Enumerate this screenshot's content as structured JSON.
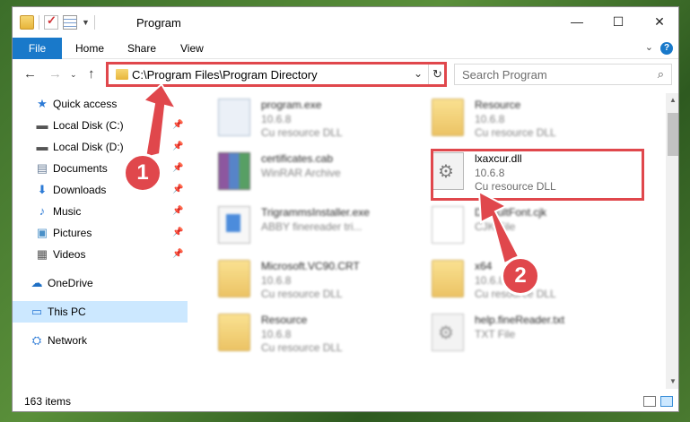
{
  "window": {
    "title": "Program",
    "controls": {
      "minimize": "—",
      "maximize": "☐",
      "close": "✕"
    }
  },
  "ribbon": {
    "tabs": [
      "File",
      "Home",
      "Share",
      "View"
    ],
    "help": "?"
  },
  "address": {
    "path": "C:\\Program Files\\Program Directory",
    "search_placeholder": "Search Program"
  },
  "sidebar": {
    "items": [
      {
        "label": "Quick access",
        "icon": "star-icon",
        "glyph": "★",
        "color": "#2d7bd6",
        "pinned": false
      },
      {
        "label": "Local Disk (C:)",
        "icon": "drive-icon",
        "glyph": "▬",
        "color": "#555555",
        "pinned": true
      },
      {
        "label": "Local Disk (D:)",
        "icon": "drive-icon",
        "glyph": "▬",
        "color": "#555555",
        "pinned": true
      },
      {
        "label": "Documents",
        "icon": "documents-icon",
        "glyph": "▤",
        "color": "#6b7f99",
        "pinned": true
      },
      {
        "label": "Downloads",
        "icon": "download-icon",
        "glyph": "⬇",
        "color": "#2d7bd6",
        "pinned": true
      },
      {
        "label": "Music",
        "icon": "music-icon",
        "glyph": "♪",
        "color": "#2d7bd6",
        "pinned": true
      },
      {
        "label": "Pictures",
        "icon": "pictures-icon",
        "glyph": "▣",
        "color": "#4a90c8",
        "pinned": true
      },
      {
        "label": "Videos",
        "icon": "videos-icon",
        "glyph": "▦",
        "color": "#555555",
        "pinned": true
      },
      {
        "label": "OneDrive",
        "icon": "cloud-icon",
        "glyph": "☁",
        "color": "#1e6fc4",
        "pinned": false
      },
      {
        "label": "This PC",
        "icon": "computer-icon",
        "glyph": "▭",
        "color": "#2d7bd6",
        "pinned": false
      },
      {
        "label": "Network",
        "icon": "network-icon",
        "glyph": "⛭",
        "color": "#2d7bd6",
        "pinned": false
      }
    ]
  },
  "files": [
    {
      "name": "program.exe",
      "sub1": "10.6.8",
      "sub2": "Cu resource DLL",
      "icon": "exe",
      "blurred": true
    },
    {
      "name": "Resource",
      "sub1": "10.6.8",
      "sub2": "Cu resource DLL",
      "icon": "folder",
      "blurred": true
    },
    {
      "name": "certificates.cab",
      "sub1": "WinRAR Archive",
      "sub2": "",
      "icon": "rar",
      "blurred": true
    },
    {
      "name": "lxaxcur.dll",
      "sub1": "10.6.8",
      "sub2": "Cu resource DLL",
      "icon": "gear",
      "blurred": false
    },
    {
      "name": "TrigrammsInstaller.exe",
      "sub1": "ABBY finereader tri...",
      "sub2": "",
      "icon": "install",
      "blurred": true
    },
    {
      "name": "DefaultFont.cjk",
      "sub1": "CJK File",
      "sub2": "",
      "icon": "doc",
      "blurred": true
    },
    {
      "name": "Microsoft.VC90.CRT",
      "sub1": "10.6.8",
      "sub2": "Cu resource DLL",
      "icon": "folder",
      "blurred": true
    },
    {
      "name": "x64",
      "sub1": "10.6.8",
      "sub2": "Cu resource DLL",
      "icon": "folder",
      "blurred": true
    },
    {
      "name": "Resource",
      "sub1": "10.6.8",
      "sub2": "Cu resource DLL",
      "icon": "folder",
      "blurred": true
    },
    {
      "name": "help.fineReader.txt",
      "sub1": "TXT File",
      "sub2": "",
      "icon": "gear",
      "blurred": true
    }
  ],
  "status": {
    "items_count": "163 items"
  },
  "annotations": {
    "badge1": "1",
    "badge2": "2",
    "color": "#e0474c"
  }
}
